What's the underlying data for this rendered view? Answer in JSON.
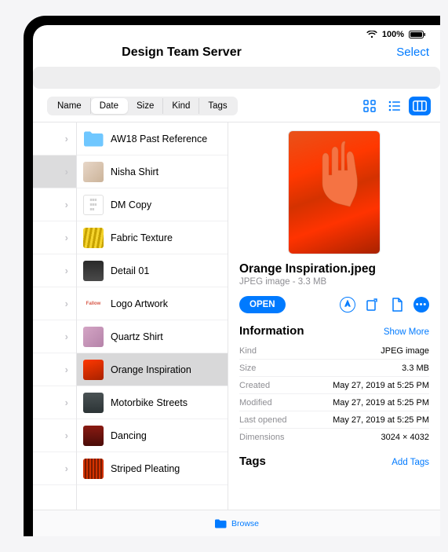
{
  "status": {
    "battery_pct": "100%"
  },
  "header": {
    "title": "Design Team Server",
    "select": "Select"
  },
  "sort": {
    "items": [
      "Name",
      "Date",
      "Size",
      "Kind",
      "Tags"
    ],
    "active": 1
  },
  "left_col": {
    "rows": 11,
    "selected_index": 1
  },
  "files": [
    {
      "label": "AW18 Past Reference",
      "type": "folder",
      "color": "#6fc7ff"
    },
    {
      "label": "Nisha Shirt",
      "type": "img",
      "bg": "linear-gradient(135deg,#e8d7c8,#cbb399)"
    },
    {
      "label": "DM Copy",
      "type": "doc"
    },
    {
      "label": "Fabric Texture",
      "type": "img",
      "bg": "repeating-linear-gradient(100deg,#f5d42e 0 3px,#c7a200 3px 6px)"
    },
    {
      "label": "Detail 01",
      "type": "img",
      "bg": "linear-gradient(#2a2a2a,#4a4a4a)"
    },
    {
      "label": "Logo Artwork",
      "type": "img",
      "bg": "#fff",
      "text": "Fallow",
      "textcolor": "#d85a4a"
    },
    {
      "label": "Quartz Shirt",
      "type": "img",
      "bg": "linear-gradient(135deg,#d4a5c5,#b583a9)"
    },
    {
      "label": "Orange Inspiration",
      "type": "img",
      "bg": "linear-gradient(160deg,#ff3800,#a82200)",
      "selected": true
    },
    {
      "label": "Motorbike Streets",
      "type": "img",
      "bg": "linear-gradient(#4a5254,#2c3436)"
    },
    {
      "label": "Dancing",
      "type": "img",
      "bg": "linear-gradient(#8a1a12,#4a0c08)"
    },
    {
      "label": "Striped Pleating",
      "type": "img",
      "bg": "repeating-linear-gradient(90deg,#d43200 0 2px,#7a1c00 2px 4px)"
    }
  ],
  "detail": {
    "filename": "Orange Inspiration.jpeg",
    "meta": "JPEG image - 3.3 MB",
    "open_label": "OPEN",
    "info_title": "Information",
    "show_more": "Show More",
    "info": [
      {
        "k": "Kind",
        "v": "JPEG image"
      },
      {
        "k": "Size",
        "v": "3.3 MB"
      },
      {
        "k": "Created",
        "v": "May 27, 2019 at 5:25 PM"
      },
      {
        "k": "Modified",
        "v": "May 27, 2019 at 5:25 PM"
      },
      {
        "k": "Last opened",
        "v": "May 27, 2019 at 5:25 PM"
      },
      {
        "k": "Dimensions",
        "v": "3024 × 4032"
      }
    ],
    "tags_title": "Tags",
    "add_tags": "Add Tags"
  },
  "bottom": {
    "browse": "Browse"
  }
}
